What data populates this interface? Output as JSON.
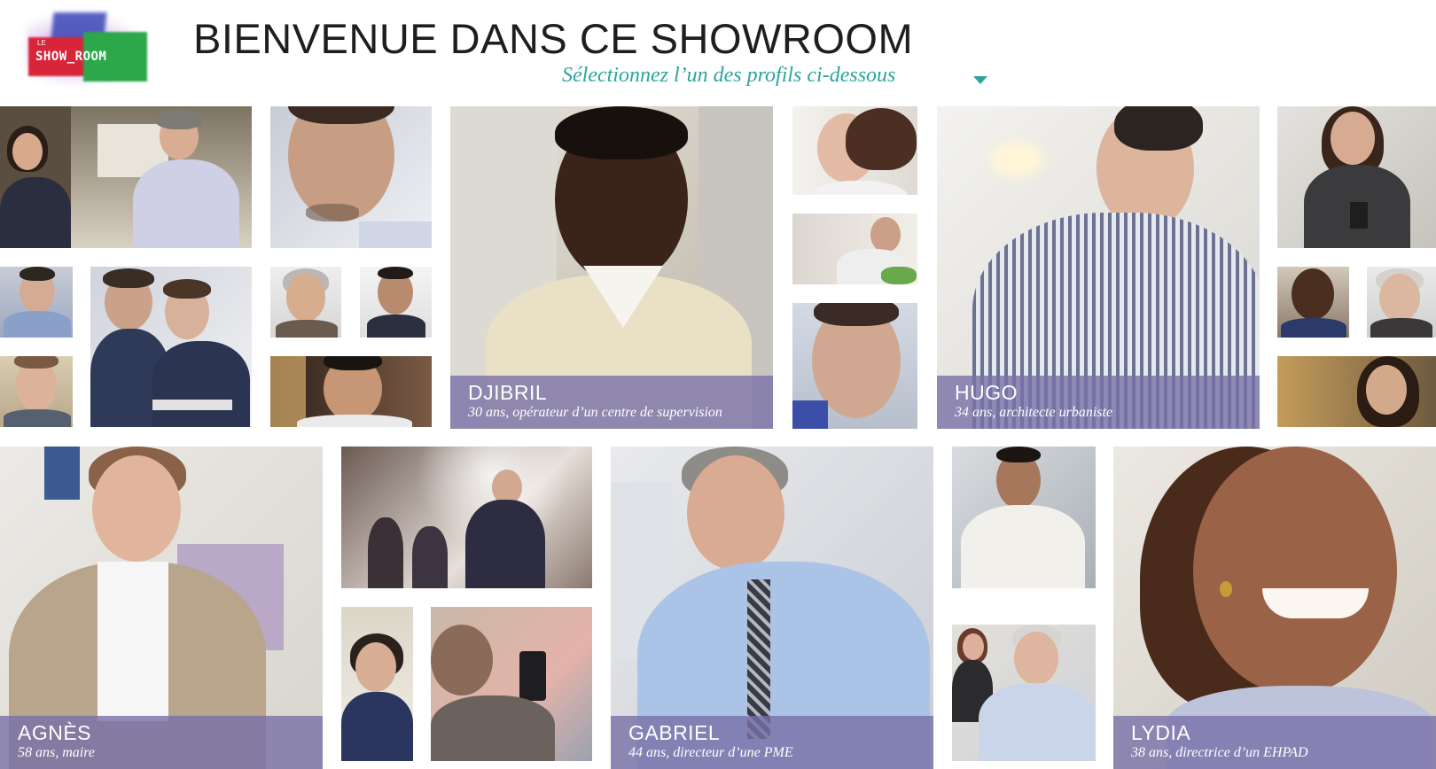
{
  "header": {
    "logo_small": "LE",
    "logo_text": "SHOW_ROOM",
    "title": "BIENVENUE DANS CE SHOWROOM",
    "subtitle": "Sélectionnez l’un des profils ci-dessous"
  },
  "profiles": [
    {
      "name": "DJIBRIL",
      "desc": "30 ans, opérateur d’un centre de supervision"
    },
    {
      "name": "HUGO",
      "desc": "34 ans, architecte urbaniste"
    },
    {
      "name": "AGNÈS",
      "desc": "58 ans, maire"
    },
    {
      "name": "GABRIEL",
      "desc": "44 ans, directeur d’une PME"
    },
    {
      "name": "LYDIA",
      "desc": "38 ans, directrice d’un EHPAD"
    }
  ]
}
